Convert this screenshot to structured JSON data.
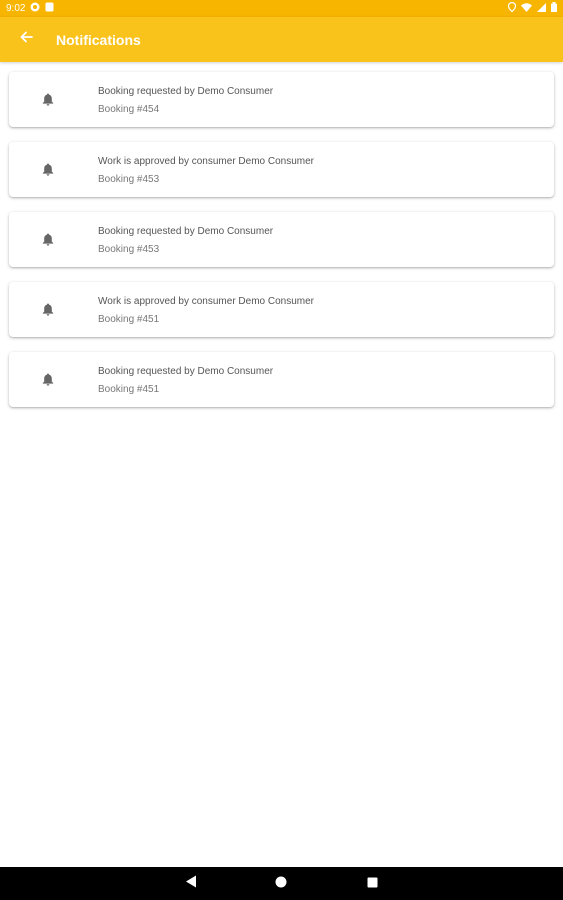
{
  "status_bar": {
    "time": "9:02",
    "left_icons": [
      "sync-icon",
      "notification-icon"
    ],
    "right_icons": [
      "location-icon",
      "wifi-icon",
      "signal-icon",
      "battery-icon"
    ]
  },
  "app_bar": {
    "title": "Notifications",
    "back_icon": "arrow-back-icon"
  },
  "notifications": [
    {
      "title": "Booking requested by Demo Consumer",
      "subtitle": "Booking #454",
      "icon": "bell-icon"
    },
    {
      "title": "Work is approved by consumer Demo Consumer",
      "subtitle": "Booking #453",
      "icon": "bell-icon"
    },
    {
      "title": "Booking requested by Demo Consumer",
      "subtitle": "Booking #453",
      "icon": "bell-icon"
    },
    {
      "title": "Work is approved by consumer Demo Consumer",
      "subtitle": "Booking #451",
      "icon": "bell-icon"
    },
    {
      "title": "Booking requested by Demo Consumer",
      "subtitle": "Booking #451",
      "icon": "bell-icon"
    }
  ],
  "nav_bar": {
    "buttons": [
      "back-triangle-icon",
      "home-circle-icon",
      "recents-square-icon"
    ]
  },
  "colors": {
    "status_bar": "#f7b500",
    "app_bar": "#f9c31c",
    "card_bg": "#ffffff",
    "nav_bar": "#000000"
  }
}
